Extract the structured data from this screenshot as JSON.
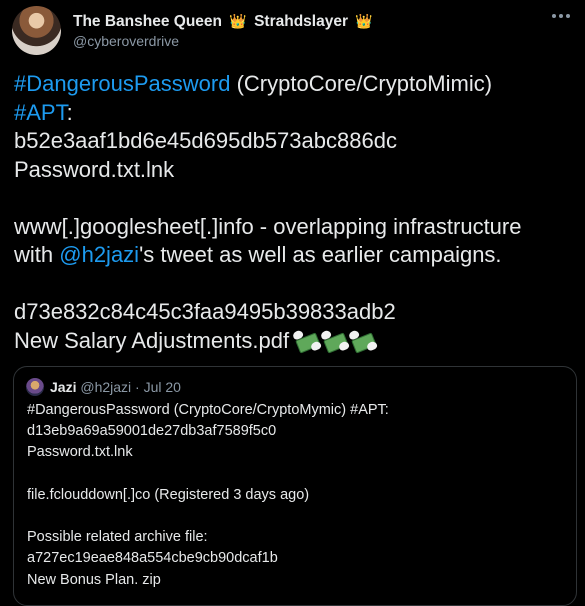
{
  "tweet": {
    "author": {
      "display_name": "The Banshee Queen",
      "crown_icon": "👑",
      "display_name_suffix": "Strahdslayer",
      "handle": "@cyberoverdrive"
    },
    "lines": [
      {
        "hashtag": "#DangerousPassword",
        "text": " (CryptoCore/CryptoMimic)"
      },
      {
        "hashtag": "#APT",
        "text": ":"
      },
      {
        "text": "b52e3aaf1bd6e45d695db573abc886dc"
      },
      {
        "text": "Password.txt.lnk"
      },
      {
        "text": ""
      },
      {
        "text": "www[.]googlesheet[.]info - overlapping infrastructure"
      },
      {
        "prefix": "with ",
        "mention": "@h2jazi",
        "text": "'s tweet as well as earlier campaigns."
      },
      {
        "text": ""
      },
      {
        "text": "d73e832c84c45c3faa9495b39833adb2"
      },
      {
        "text": "New Salary Adjustments.pdf"
      }
    ],
    "emoji": "money-with-wings-emoji",
    "emoji_count": 3
  },
  "quoted_tweet": {
    "display_name": "Jazi",
    "handle": "@h2jazi",
    "separator": "·",
    "date": "Jul 20",
    "lines": [
      "#DangerousPassword (CryptoCore/CryptoMymic) #APT:",
      "d13eb9a69a59001de27db3af7589f5c0",
      "Password.txt.lnk",
      "",
      "file.fclouddown[.]co (Registered 3 days ago)",
      "",
      "Possible related archive file:",
      "a727ec19eae848a554cbe9cb90dcaf1b",
      "New Bonus Plan. zip"
    ]
  },
  "colors": {
    "background": "#000000",
    "text": "#e7e9ea",
    "muted": "#8b98a5",
    "link": "#1d9bf0",
    "border": "#2f3336"
  }
}
